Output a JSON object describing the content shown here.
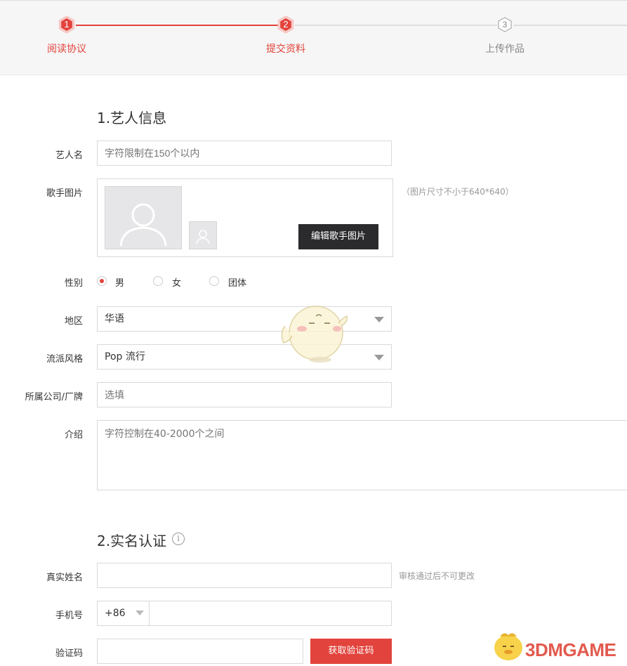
{
  "steps": [
    {
      "num": "1",
      "label": "阅读协议",
      "state": "done"
    },
    {
      "num": "2",
      "label": "提交资料",
      "state": "active"
    },
    {
      "num": "3",
      "label": "上传作品",
      "state": "todo"
    }
  ],
  "colors": {
    "accent": "#e2433c",
    "dark": "#2b2b2e",
    "muted": "#999999"
  },
  "section1": {
    "title": "1.艺人信息",
    "artist_name": {
      "label": "艺人名",
      "placeholder": "字符限制在150个以内"
    },
    "photo": {
      "label": "歌手图片",
      "hint": "（图片尺寸不小于640*640）",
      "button": "编辑歌手图片"
    },
    "gender": {
      "label": "性别",
      "options": [
        "男",
        "女",
        "团体"
      ],
      "selected": "男"
    },
    "region": {
      "label": "地区",
      "value": "华语"
    },
    "genre": {
      "label": "流派风格",
      "value": "Pop 流行"
    },
    "company": {
      "label": "所属公司/厂牌",
      "placeholder": "选填"
    },
    "intro": {
      "label": "介绍",
      "placeholder": "字符控制在40-2000个之间"
    }
  },
  "section2": {
    "title": "2.实名认证",
    "real_name": {
      "label": "真实姓名",
      "hint": "审核通过后不可更改"
    },
    "phone": {
      "label": "手机号",
      "prefix": "+86"
    },
    "code": {
      "label": "验证码",
      "button": "获取验证码"
    }
  },
  "watermark": {
    "text": "3DMGAME"
  }
}
